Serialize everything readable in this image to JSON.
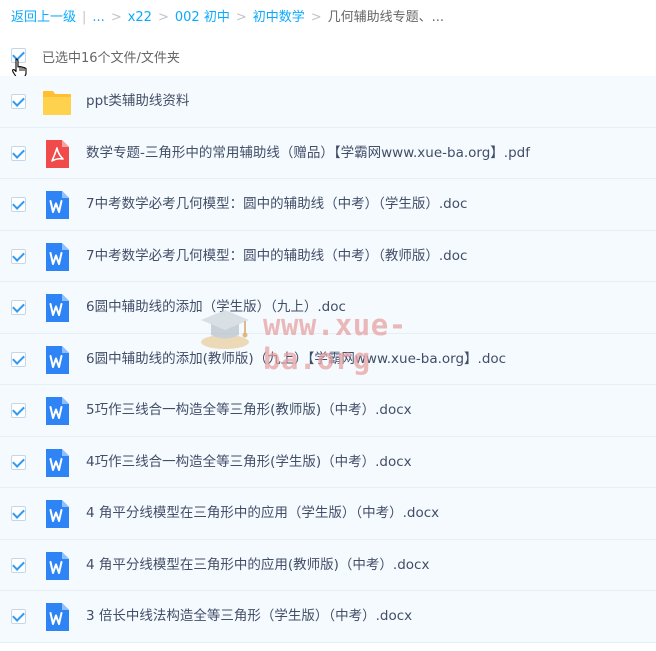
{
  "breadcrumb": {
    "back": "返回上一级",
    "ellipsis": "...",
    "items": [
      "x22",
      "002 初中",
      "初中数学"
    ],
    "current": "几何辅助线专题、..."
  },
  "selection": {
    "label": "已选中16个文件/文件夹"
  },
  "files": [
    {
      "name": "ppt类辅助线资料",
      "icon": "folder-icon"
    },
    {
      "name": "数学专题-三角形中的常用辅助线（赠品）【学霸网www.xue-ba.org】.pdf",
      "icon": "pdf-file-icon"
    },
    {
      "name": "7中考数学必考几何模型：圆中的辅助线（中考）（学生版）.doc",
      "icon": "word-file-icon"
    },
    {
      "name": "7中考数学必考几何模型：圆中的辅助线（中考）（教师版）.doc",
      "icon": "word-file-icon"
    },
    {
      "name": "6圆中辅助线的添加（学生版）（九上）.doc",
      "icon": "word-file-icon"
    },
    {
      "name": "6圆中辅助线的添加(教师版)（九上）【学霸网www.xue-ba.org】.doc",
      "icon": "word-file-icon"
    },
    {
      "name": "5巧作三线合一构造全等三角形(教师版)（中考）.docx",
      "icon": "word-file-icon"
    },
    {
      "name": "4巧作三线合一构造全等三角形(学生版)（中考）.docx",
      "icon": "word-file-icon"
    },
    {
      "name": "4 角平分线模型在三角形中的应用（学生版）（中考）.docx",
      "icon": "word-file-icon"
    },
    {
      "name": "4 角平分线模型在三角形中的应用(教师版)（中考）.docx",
      "icon": "word-file-icon"
    },
    {
      "name": "3 倍长中线法构造全等三角形（学生版）（中考）.docx",
      "icon": "word-file-icon"
    }
  ],
  "watermark": {
    "text": "www.xue-ba.org"
  },
  "colors": {
    "link": "#09aaff",
    "check": "#2f9bf3",
    "row_bg": "#f5faff",
    "folder": "#ffc93d",
    "pdf": "#f05050",
    "word": "#2e84f5"
  }
}
